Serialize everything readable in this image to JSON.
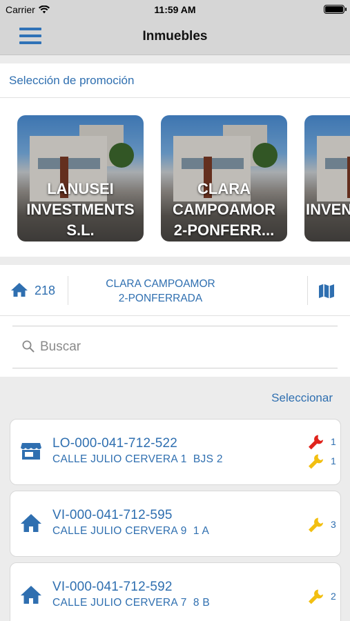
{
  "status": {
    "carrier": "Carrier",
    "time": "11:59 AM"
  },
  "navbar": {
    "title": "Inmuebles",
    "menu_icon": "hamburger-menu-icon"
  },
  "promotion_selector": {
    "label": "Selección de promoción",
    "cards": [
      {
        "name_lines": [
          "LANUSEI",
          "INVESTMENTS",
          "S.L."
        ]
      },
      {
        "name_lines": [
          "CLARA",
          "CAMPOAMOR",
          "2-PONFERR..."
        ]
      },
      {
        "name_lines": [
          "",
          "INVEN",
          ""
        ]
      }
    ]
  },
  "summary": {
    "count": "218",
    "promotion_lines": [
      "CLARA CAMPOAMOR",
      "2-PONFERRADA"
    ],
    "home_icon": "home-icon",
    "map_icon": "map-icon"
  },
  "search": {
    "placeholder": "Buscar",
    "value": ""
  },
  "select_label": "Seleccionar",
  "colors": {
    "accent": "#2f6fb0",
    "repair_red": "#e0231c",
    "repair_yellow": "#f2bf11",
    "navbar_bg": "#d6d6d6"
  },
  "properties": [
    {
      "type_icon": "store-icon",
      "code": "LO-000-041-712-522",
      "address": "CALLE JULIO CERVERA 1  BJS 2",
      "incidents": [
        {
          "icon": "wrench-red-icon",
          "count": "1"
        },
        {
          "icon": "wrench-yellow-icon",
          "count": "1"
        }
      ]
    },
    {
      "type_icon": "home-icon",
      "code": "VI-000-041-712-595",
      "address": "CALLE JULIO CERVERA 9  1 A",
      "incidents": [
        {
          "icon": "wrench-yellow-icon",
          "count": "3"
        }
      ]
    },
    {
      "type_icon": "home-icon",
      "code": "VI-000-041-712-592",
      "address": "CALLE JULIO CERVERA 7  8 B",
      "incidents": [
        {
          "icon": "wrench-yellow-icon",
          "count": "2"
        }
      ]
    }
  ]
}
